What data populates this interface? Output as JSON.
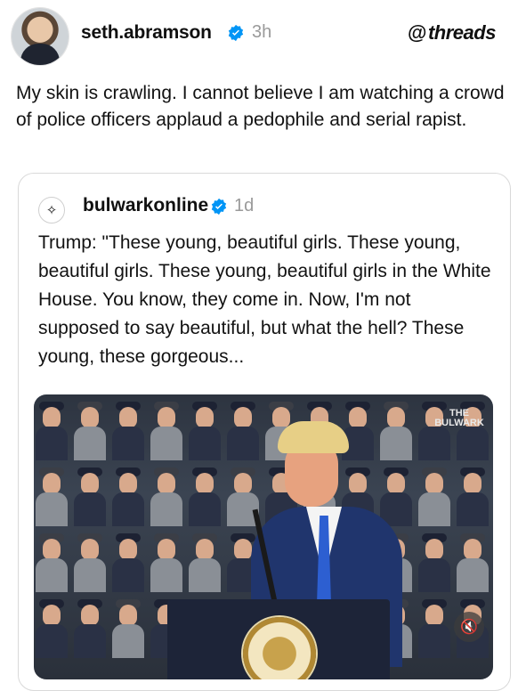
{
  "post": {
    "username": "seth.abramson",
    "time": "3h",
    "brand": "threads",
    "text": "My skin is crawling. I cannot believe I am watching a crowd of police officers applaud a pedophile and serial rapist."
  },
  "quoted": {
    "username": "bulwarkonline",
    "time": "1d",
    "text": "Trump: \"These young, beautiful girls. These young, beautiful girls. These young, beautiful girls in the White House. You know, they come in. Now, I'm not supposed to say beautiful, but what the hell? These young, these gorgeous...",
    "watermark": "THE BULWARK"
  },
  "colors": {
    "verified": "#0095f6",
    "muted_text": "#9a9a9a"
  },
  "icons": {
    "verified": "verified-badge-icon",
    "threads": "threads-logo-icon",
    "mute": "speaker-muted-icon"
  }
}
